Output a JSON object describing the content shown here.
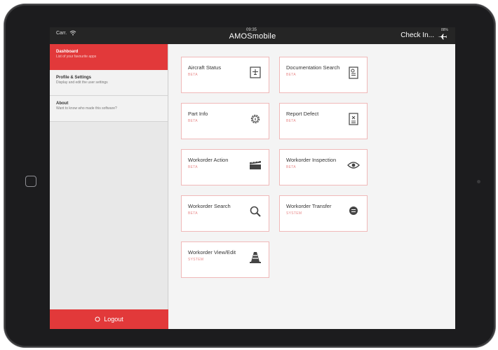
{
  "statusbar": {
    "carrier": "Carr.",
    "clock": "09:35",
    "app_title": "AMOSmobile",
    "checkin_label": "Check In...",
    "battery": "88%"
  },
  "sidebar": {
    "items": [
      {
        "title": "Dashboard",
        "subtitle": "List of your favourite apps",
        "active": true
      },
      {
        "title": "Profile & Settings",
        "subtitle": "Display and edit the user settings",
        "active": false
      },
      {
        "title": "About",
        "subtitle": "Want to know who made this software?",
        "active": false
      }
    ],
    "logout_label": "Logout"
  },
  "tiles": [
    {
      "name": "Aircraft Status",
      "badge": "BETA",
      "icon": "aircraft-status-icon"
    },
    {
      "name": "Documentation Search",
      "badge": "BETA",
      "icon": "document-search-icon"
    },
    {
      "name": "Part Info",
      "badge": "BETA",
      "icon": "gear-info-icon"
    },
    {
      "name": "Report Defect",
      "badge": "BETA",
      "icon": "report-document-icon"
    },
    {
      "name": "Workorder Action",
      "badge": "BETA",
      "icon": "clapperboard-icon"
    },
    {
      "name": "Workorder Inspection",
      "badge": "BETA",
      "icon": "eye-icon"
    },
    {
      "name": "Workorder Search",
      "badge": "BETA",
      "icon": "magnifier-icon"
    },
    {
      "name": "Workorder Transfer",
      "badge": "SYSTEM",
      "icon": "transfer-icon"
    },
    {
      "name": "Workorder View/Edit",
      "badge": "SYSTEM",
      "icon": "traffic-cone-icon"
    }
  ],
  "colors": {
    "accent": "#e2393a",
    "tile_border": "#f0b8b8",
    "statusbar": "#252525"
  }
}
